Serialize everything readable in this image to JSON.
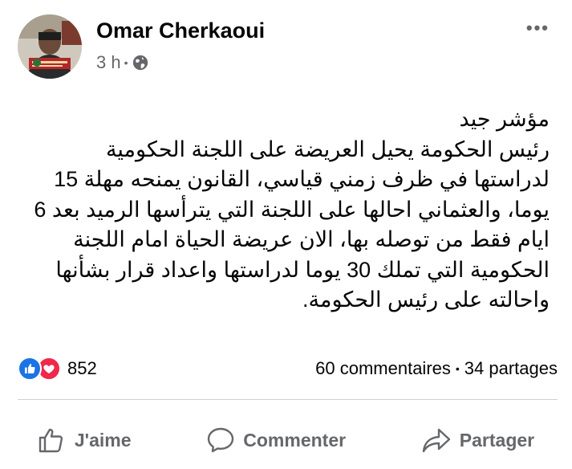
{
  "post": {
    "author": "Omar Cherkaoui",
    "time": "3 h",
    "separator": "•",
    "audience_icon": "globe-icon",
    "more_icon": "more-options-icon",
    "more_label": "•••",
    "lines": [
      "مؤشر جيد",
      "رئيس الحكومة يحيل العريضة على اللجنة الحكومية",
      "لدراستها في ظرف زمني قياسي، القانون يمنحه مهلة 15",
      "يوما، والعثماني احالها على اللجنة التي يترأسها الرميد بعد 6",
      "ايام فقط من توصله بها، الان عريضة الحياة امام اللجنة",
      "الحكومية التي تملك 30 يوما لدراستها واعداد قرار بشأنها",
      "واحالته على رئيس الحكومة."
    ],
    "reactions": {
      "count": "852",
      "types": [
        "like",
        "love"
      ]
    },
    "comments": "60 commentaires",
    "stats_separator": "•",
    "shares": "34 partages",
    "actions": {
      "like": "J'aime",
      "comment": "Commenter",
      "share": "Partager"
    },
    "colors": {
      "like_blue": "#1b74e4",
      "love_red": "#f0284a",
      "secondary_text": "#65676b"
    }
  }
}
